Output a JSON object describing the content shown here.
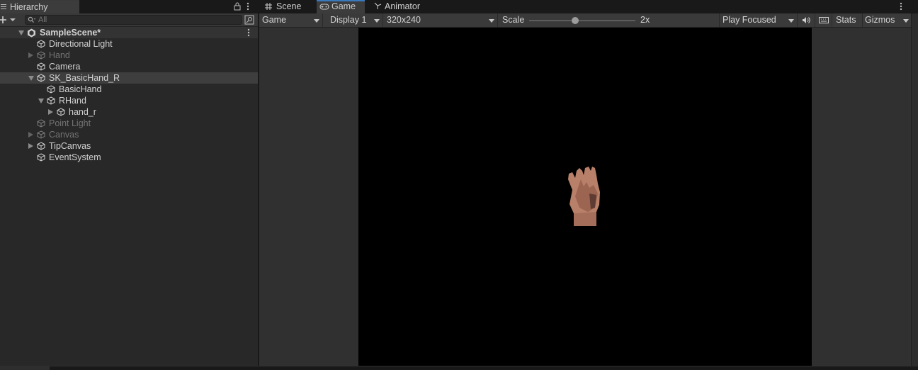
{
  "hierarchy": {
    "tab_label": "Hierarchy",
    "search_placeholder": "All",
    "items": [
      {
        "label": "SampleScene*",
        "icon": "unity-scene-icon",
        "expanded": true
      },
      {
        "label": "Directional Light",
        "icon": "gameobject-cube-icon"
      },
      {
        "label": "Hand",
        "icon": "gameobject-cube-icon",
        "inactive": true,
        "collapsed": true
      },
      {
        "label": "Camera",
        "icon": "gameobject-cube-icon"
      },
      {
        "label": "SK_BasicHand_R",
        "icon": "gameobject-cube-icon",
        "expanded": true,
        "selected": true
      },
      {
        "label": "BasicHand",
        "icon": "gameobject-cube-icon"
      },
      {
        "label": "RHand",
        "icon": "gameobject-cube-icon",
        "expanded": true
      },
      {
        "label": "hand_r",
        "icon": "gameobject-cube-icon",
        "collapsed": true
      },
      {
        "label": "Point Light",
        "icon": "gameobject-cube-icon",
        "inactive": true
      },
      {
        "label": "Canvas",
        "icon": "gameobject-cube-icon",
        "inactive": true,
        "collapsed": true
      },
      {
        "label": "TipCanvas",
        "icon": "gameobject-cube-icon",
        "collapsed": true
      },
      {
        "label": "EventSystem",
        "icon": "gameobject-cube-icon"
      }
    ]
  },
  "tabs": {
    "scene": "Scene",
    "game": "Game",
    "animator": "Animator"
  },
  "game_toolbar": {
    "view_mode": "Game",
    "display": "Display 1",
    "resolution": "320x240",
    "scale_label": "Scale",
    "scale_value": "2x",
    "scale_fraction": 0.43,
    "play_mode": "Play Focused",
    "stats": "Stats",
    "gizmos": "Gizmos"
  },
  "colors": {
    "panel": "#282828",
    "toolbar": "#3a3a3a",
    "selected_row": "#3e3e3e",
    "active_tab_accent": "#3a79bb",
    "render_bg": "#000000"
  }
}
